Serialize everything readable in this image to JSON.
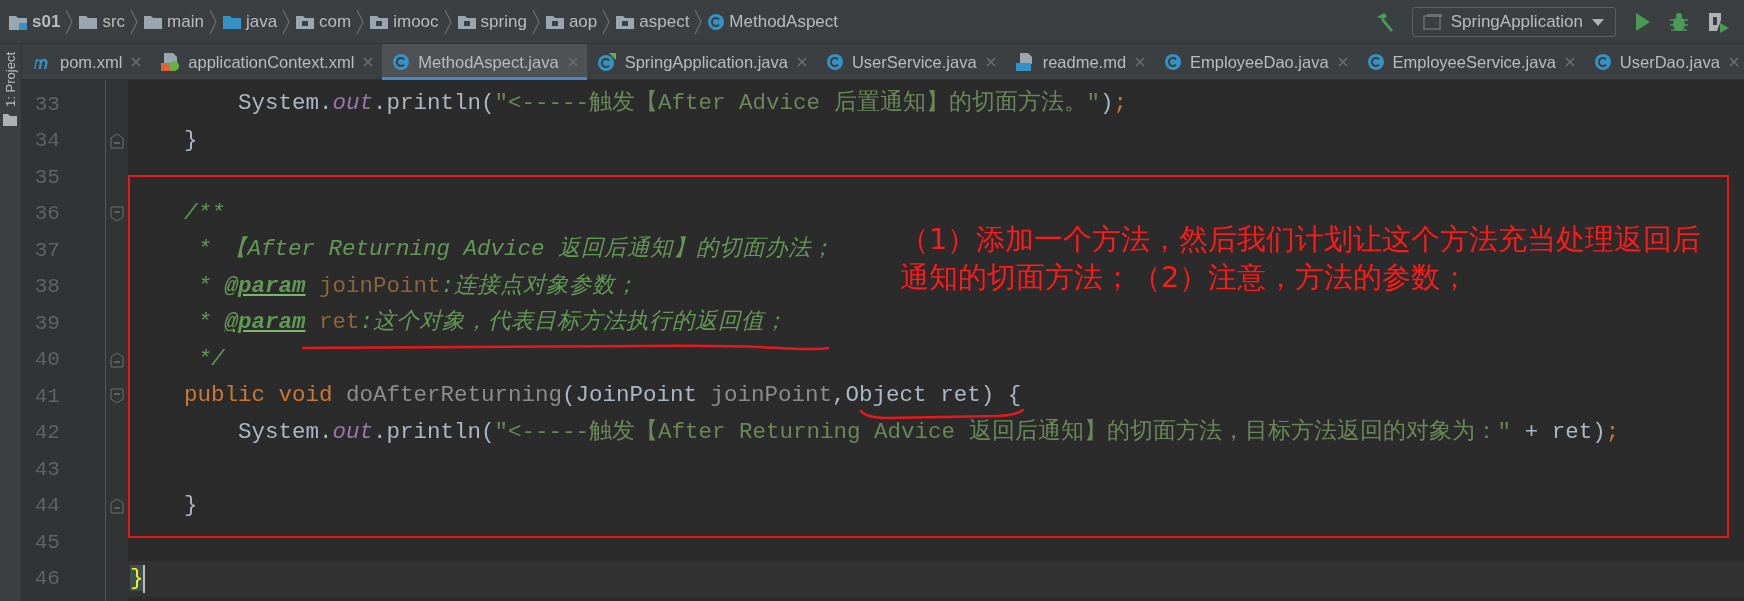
{
  "breadcrumbs": [
    {
      "label": "s01",
      "kind": "module"
    },
    {
      "label": "src",
      "kind": "folder"
    },
    {
      "label": "main",
      "kind": "folder"
    },
    {
      "label": "java",
      "kind": "source-folder"
    },
    {
      "label": "com",
      "kind": "package"
    },
    {
      "label": "imooc",
      "kind": "package"
    },
    {
      "label": "spring",
      "kind": "package"
    },
    {
      "label": "aop",
      "kind": "package"
    },
    {
      "label": "aspect",
      "kind": "package"
    },
    {
      "label": "MethodAspect",
      "kind": "class"
    }
  ],
  "run_config": {
    "label": "SpringApplication"
  },
  "side_panel": {
    "label": "1: Project"
  },
  "tabs": [
    {
      "label": "pom.xml",
      "kind": "maven",
      "selected": false
    },
    {
      "label": "applicationContext.xml",
      "kind": "xml",
      "selected": false
    },
    {
      "label": "MethodAspect.java",
      "kind": "class",
      "selected": true
    },
    {
      "label": "SpringApplication.java",
      "kind": "spring-class",
      "selected": false
    },
    {
      "label": "UserService.java",
      "kind": "class",
      "selected": false
    },
    {
      "label": "readme.md",
      "kind": "markdown",
      "selected": false
    },
    {
      "label": "EmployeeDao.java",
      "kind": "class",
      "selected": false
    },
    {
      "label": "EmployeeService.java",
      "kind": "class",
      "selected": false
    },
    {
      "label": "UserDao.java",
      "kind": "class",
      "selected": false
    }
  ],
  "editor": {
    "lines": [
      {
        "number": "33",
        "current": false,
        "tokens": [
          {
            "text": "        System.",
            "kind": "plain"
          },
          {
            "text": "out",
            "kind": "static"
          },
          {
            "text": ".println(",
            "kind": "plain"
          },
          {
            "text": "\"<-----触发【After Advice 后置通知】的切面方法。\"",
            "kind": "string"
          },
          {
            "text": ")",
            "kind": "plain"
          },
          {
            "text": ";",
            "kind": "keyword"
          }
        ]
      },
      {
        "number": "34",
        "current": false,
        "fold_end": true,
        "tokens": [
          {
            "text": "    }",
            "kind": "plain"
          }
        ]
      },
      {
        "number": "35",
        "current": false
      },
      {
        "number": "36",
        "current": false,
        "fold_start": true,
        "tokens": [
          {
            "text": "    /**",
            "kind": "doc"
          }
        ]
      },
      {
        "number": "37",
        "current": false,
        "tokens": [
          {
            "text": "     * 【After Returning Advice 返回后通知】的切面办法；",
            "kind": "doc"
          }
        ]
      },
      {
        "number": "38",
        "current": false,
        "tokens": [
          {
            "text": "     * ",
            "kind": "doc"
          },
          {
            "text": "@param",
            "kind": "doctag"
          },
          {
            "text": " joinPoint",
            "kind": "docparam"
          },
          {
            "text": ":连接点对象参数；",
            "kind": "doc"
          }
        ]
      },
      {
        "number": "39",
        "current": false,
        "tokens": [
          {
            "text": "     * ",
            "kind": "doc"
          },
          {
            "text": "@param",
            "kind": "doctag"
          },
          {
            "text": " ret",
            "kind": "docparam"
          },
          {
            "text": ":这个对象，代表目标方法执行的返回值；",
            "kind": "doc"
          }
        ]
      },
      {
        "number": "40",
        "current": false,
        "fold_end": true,
        "tokens": [
          {
            "text": "     */",
            "kind": "doc"
          }
        ]
      },
      {
        "number": "41",
        "current": false,
        "fold_start": true,
        "tokens": [
          {
            "text": "    public void ",
            "kind": "keyword"
          },
          {
            "text": "doAfterReturning",
            "kind": "unused"
          },
          {
            "text": "(JoinPoint ",
            "kind": "plain"
          },
          {
            "text": "joinPoint",
            "kind": "unused"
          },
          {
            "text": ",Object ret) {",
            "kind": "plain"
          }
        ]
      },
      {
        "number": "42",
        "current": false,
        "tokens": [
          {
            "text": "        System.",
            "kind": "plain"
          },
          {
            "text": "out",
            "kind": "static"
          },
          {
            "text": ".println(",
            "kind": "plain"
          },
          {
            "text": "\"<-----触发【After Returning Advice 返回后通知】的切面方法，目标方法返回的对象为：\"",
            "kind": "string"
          },
          {
            "text": " + ret)",
            "kind": "plain"
          },
          {
            "text": ";",
            "kind": "keyword"
          }
        ]
      },
      {
        "number": "43",
        "current": false
      },
      {
        "number": "44",
        "current": false,
        "fold_end": true,
        "tokens": [
          {
            "text": "    }",
            "kind": "plain"
          }
        ]
      },
      {
        "number": "45",
        "current": false
      },
      {
        "number": "46",
        "current": true,
        "tokens": [
          {
            "text": "}",
            "kind": "brace-match"
          }
        ]
      }
    ]
  },
  "annotation": {
    "note": "（1）添加一个方法，然后我们计划让这个方法充当处理返回后通知的切面方法；（2）注意，方法的参数；"
  }
}
